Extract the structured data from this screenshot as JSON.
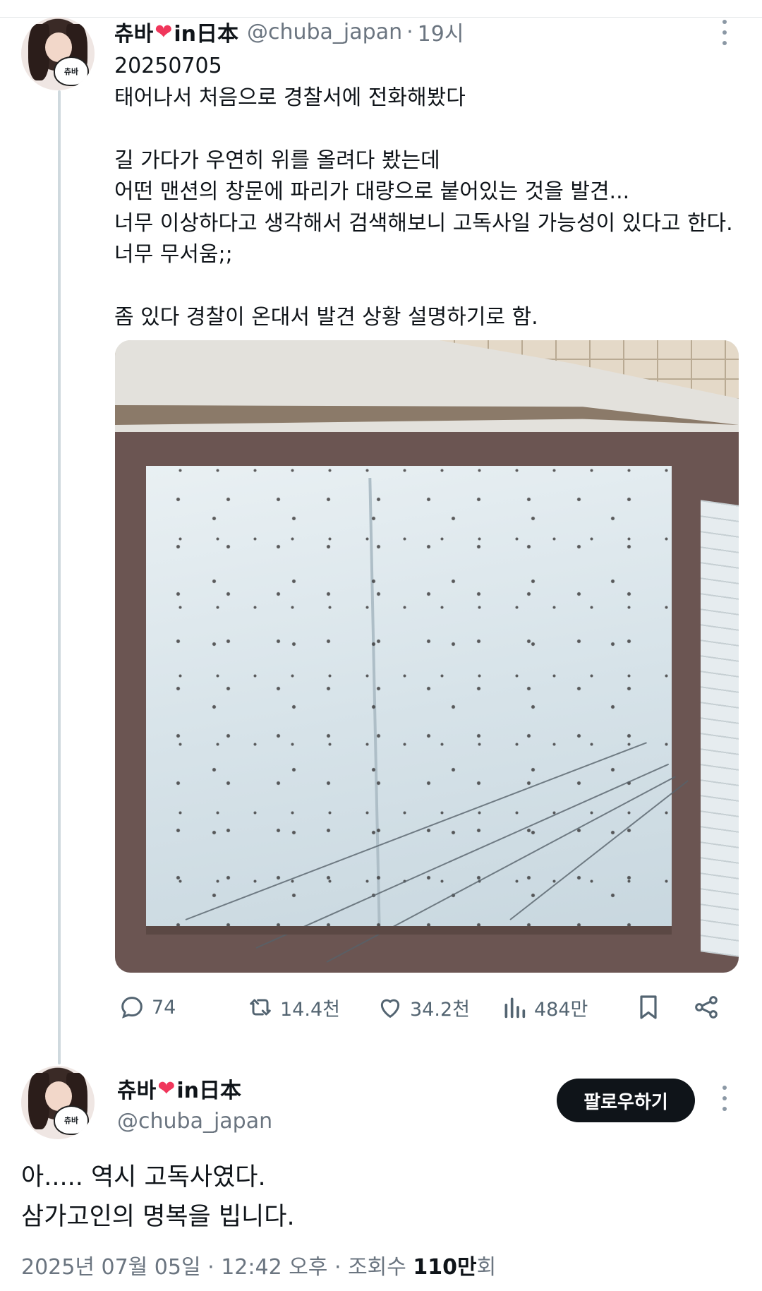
{
  "post": {
    "author": {
      "name": "츄바",
      "name_suffix": "in日本",
      "heart": "❤",
      "handle": "@chuba_japan",
      "avatar_badge": "츄바"
    },
    "time": "19시",
    "text": "20250705\n태어나서 처음으로 경찰서에 전화해봤다\n\n길 가다가 우연히 위를 올려다 봤는데\n어떤 맨션의 창문에 파리가 대량으로 붙어있는 것을 발견...\n너무 이상하다고 생각해서 검색해보니 고독사일 가능성이 있다고 한다.\n너무 무서움;;\n\n좀 있다 경찰이 온대서 발견 상황 설명하기로 함.",
    "image_alt": "",
    "actions": {
      "replies": "74",
      "reposts": "14.4천",
      "likes": "34.2천",
      "views": "484만"
    }
  },
  "reply": {
    "author": {
      "name": "츄바",
      "name_suffix": "in日本",
      "heart": "❤",
      "handle": "@chuba_japan",
      "avatar_badge": "츄바"
    },
    "follow_label": "팔로우하기",
    "text": "아..... 역시 고독사였다.\n삼가고인의 명복을 빕니다.",
    "meta": {
      "date": "2025년 07월 05일",
      "time": "12:42 오후",
      "views_label": "조회수",
      "views_count": "110만",
      "views_suffix": "회",
      "separator": "·"
    }
  },
  "colors": {
    "accent_text": "#0f1419",
    "muted": "#6b7580",
    "heart": "#f0365b",
    "icon": "#536471"
  }
}
